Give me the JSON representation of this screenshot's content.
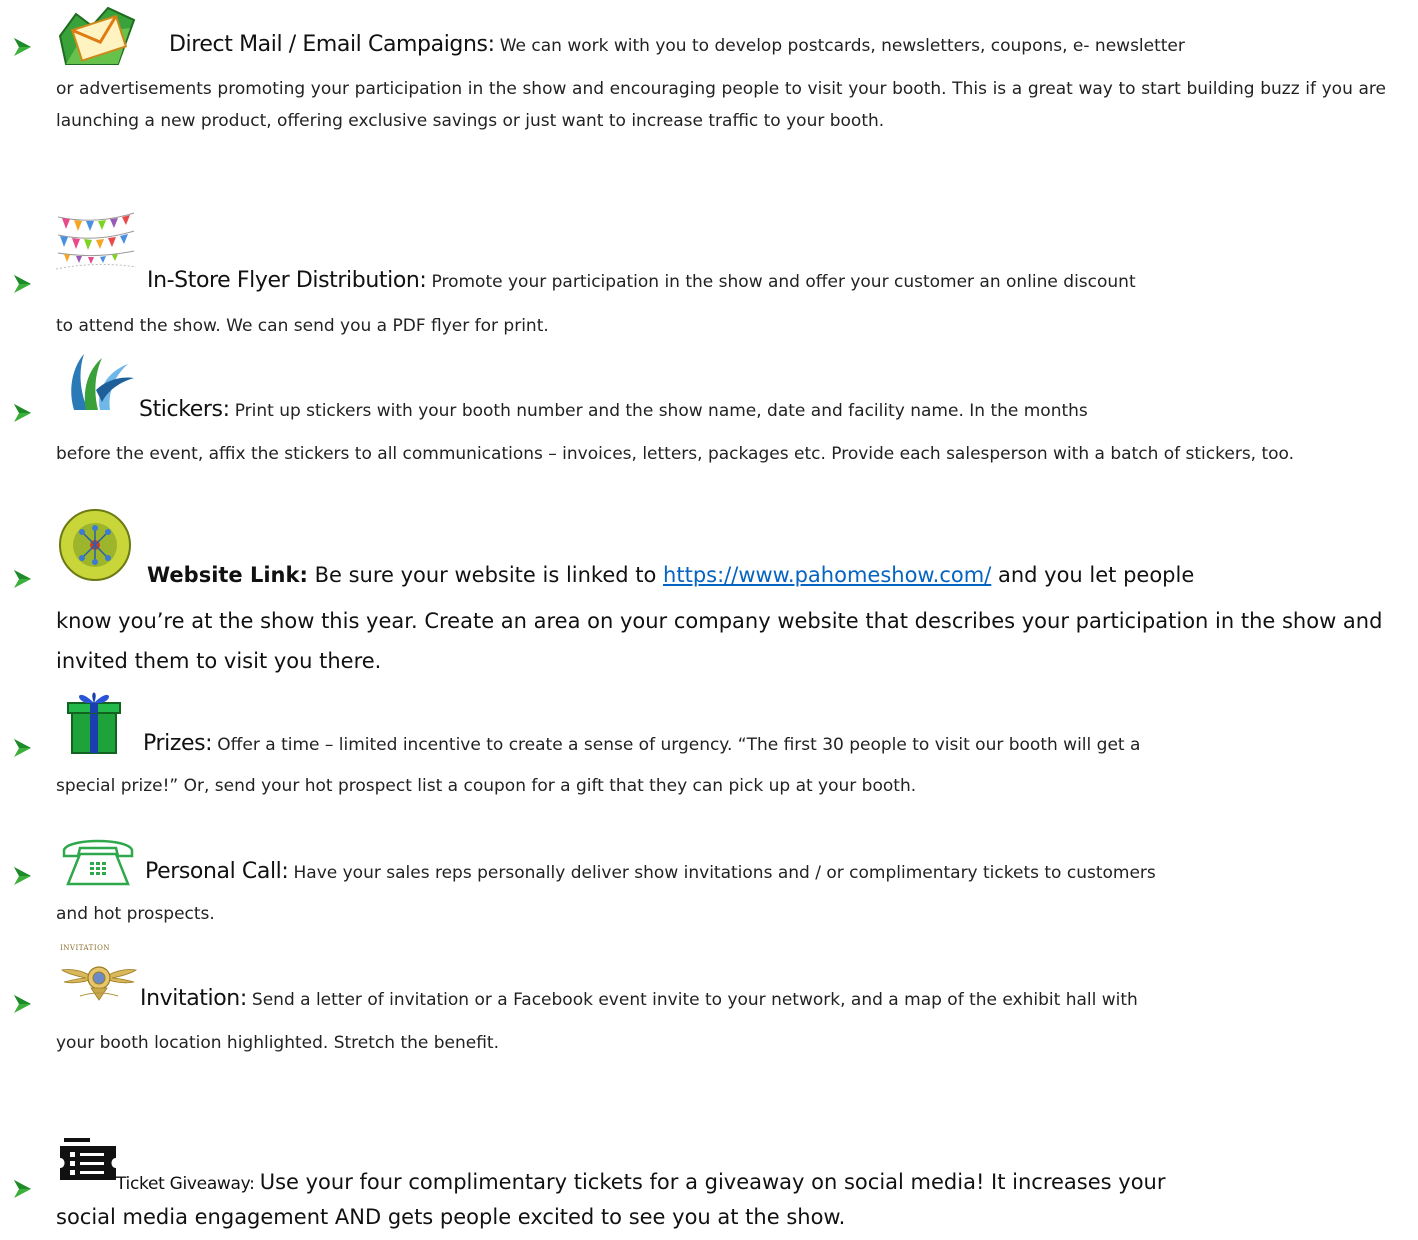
{
  "items": [
    {
      "icon": "envelope-folder-icon",
      "heading": "Direct Mail / Email Campaigns:",
      "line1": "We can work with you to develop postcards, newsletters, coupons, e- newsletter",
      "rest": "or advertisements promoting your participation in the show and encouraging people to visit your booth. This is a great way to start building buzz if you are launching a new product, offering exclusive savings or just want to increase traffic to your booth."
    },
    {
      "icon": "bunting-flags-icon",
      "heading": "In-Store Flyer Distribution:",
      "line1": "Promote your participation in the show and offer your customer an online discount",
      "rest": "to attend the show. We can send you a PDF flyer for print."
    },
    {
      "icon": "swoosh-logo-icon",
      "heading": "Stickers:",
      "line1": "Print up stickers with your booth number and the show name, date and facility name. In the months",
      "rest": "before the event, affix the stickers to all communications – invoices, letters, packages etc. Provide each salesperson with a batch of stickers, too."
    },
    {
      "icon": "link-popularity-badge-icon",
      "heading": "Website Link:",
      "line1_pre": "Be sure your website is linked to",
      "link": "https://www.pahomeshow.com/",
      "line1_post": "and you let people",
      "rest": "know you’re at the show this year. Create an area on your company website that describes your participation in the show and invited them to visit you there."
    },
    {
      "icon": "gift-box-icon",
      "heading": "Prizes:",
      "line1": "Offer a time – limited incentive to create a sense of urgency. “The first 30 people to visit our booth will get a",
      "rest": "special prize!” Or, send your hot prospect list a coupon for a gift that they can pick up at your booth."
    },
    {
      "icon": "telephone-icon",
      "heading": "Personal Call:",
      "line1": "Have your sales reps personally deliver show invitations and / or complimentary tickets to customers",
      "rest": "and hot prospects."
    },
    {
      "icon": "invitation-crest-icon",
      "icon_caption": "INVITATION",
      "heading": "Invitation:",
      "line1": "Send a letter of invitation or a Facebook event invite to your network, and a map of the exhibit hall with",
      "rest": "your booth location highlighted. Stretch the benefit."
    },
    {
      "icon": "ticket-icon",
      "heading": "Ticket Giveaway:",
      "line1": "Use your four complimentary tickets for a giveaway on social media!  It increases your",
      "rest": "social media engagement AND gets people excited to see you at the show."
    }
  ],
  "colors": {
    "bullet": "#3bb03b",
    "link": "#0563c1"
  }
}
